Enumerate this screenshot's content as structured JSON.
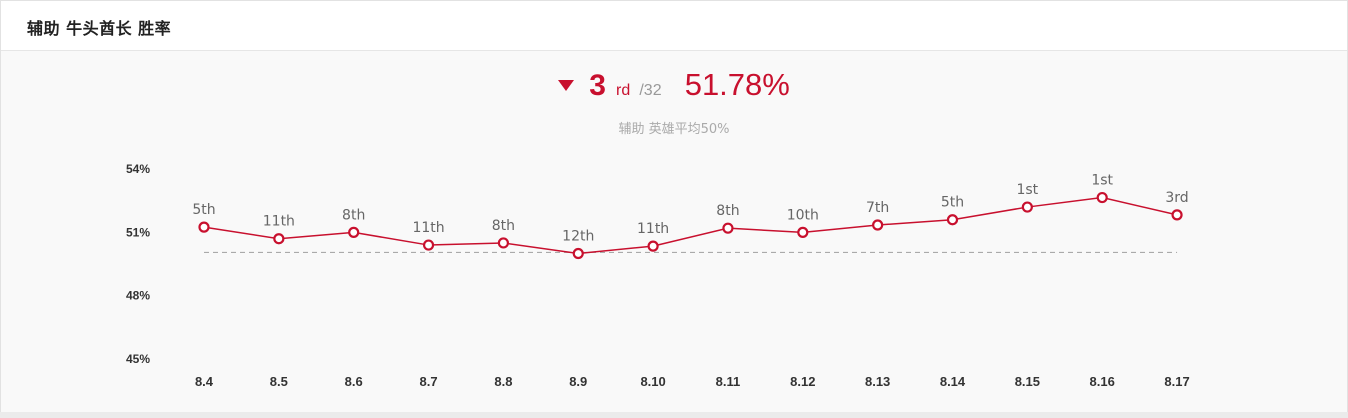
{
  "header": {
    "title": "辅助 牛头酋长 胜率"
  },
  "summary": {
    "trend_icon": "triangle-down-icon",
    "rank": "3",
    "rank_suffix": "rd",
    "rank_total": "/32",
    "winrate": "51.78%",
    "subtitle": "辅助 英雄平均50%"
  },
  "colors": {
    "accent": "#c8102e",
    "reference_line": "#aaaaaa"
  },
  "chart_data": {
    "type": "line",
    "categories": [
      "8.4",
      "8.5",
      "8.6",
      "8.7",
      "8.8",
      "8.9",
      "8.10",
      "8.11",
      "8.12",
      "8.13",
      "8.14",
      "8.15",
      "8.16",
      "8.17"
    ],
    "series": [
      {
        "values": [
          51.2,
          50.65,
          50.95,
          50.35,
          50.45,
          49.95,
          50.3,
          51.15,
          50.95,
          51.3,
          51.55,
          52.15,
          52.6,
          51.78
        ],
        "labels": [
          "5th",
          "11th",
          "8th",
          "11th",
          "8th",
          "12th",
          "11th",
          "8th",
          "10th",
          "7th",
          "5th",
          "1st",
          "1st",
          "3rd"
        ]
      }
    ],
    "yticks": [
      45,
      48,
      51,
      54
    ],
    "ytick_labels": [
      "45%",
      "48%",
      "51%",
      "54%"
    ],
    "ylim": [
      45,
      54
    ],
    "reference_value": 50,
    "grid": false
  }
}
